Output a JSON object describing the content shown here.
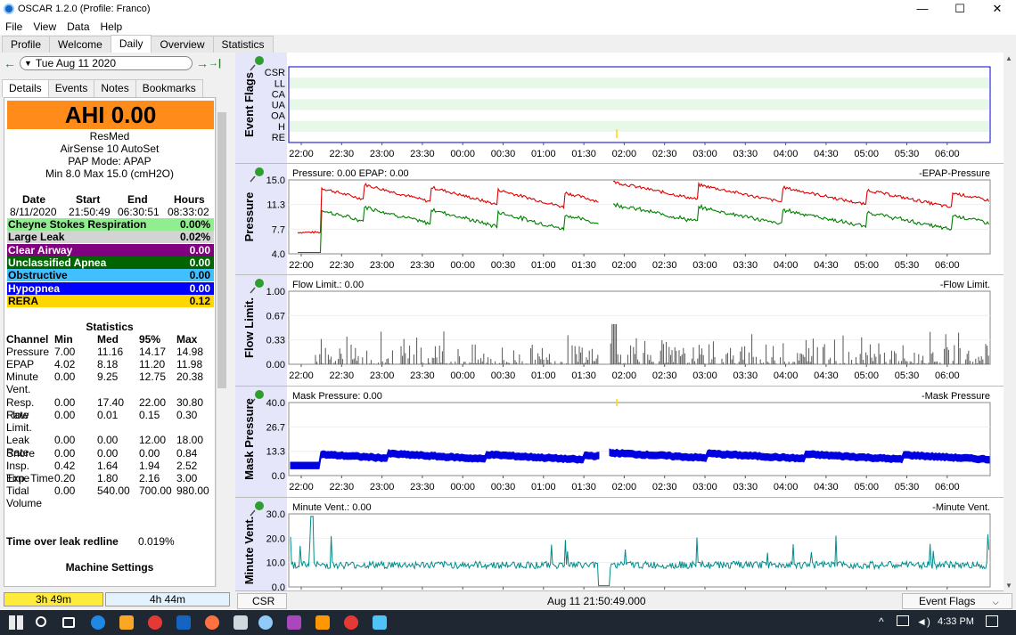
{
  "window": {
    "title": "OSCAR 1.2.0 (Profile: Franco)",
    "minimize": "—",
    "maximize": "☐",
    "close": "✕"
  },
  "menu": [
    "File",
    "View",
    "Data",
    "Help"
  ],
  "tabs": [
    "Profile",
    "Welcome",
    "Daily",
    "Overview",
    "Statistics"
  ],
  "active_tab": "Daily",
  "date": {
    "value": "Tue Aug 11 2020",
    "prev": "←",
    "next": "→",
    "last": "→|"
  },
  "subtabs": [
    "Details",
    "Events",
    "Notes",
    "Bookmarks"
  ],
  "ahi": "AHI 0.00",
  "machine": {
    "brand": "ResMed",
    "model": "AirSense 10 AutoSet",
    "mode": "PAP Mode: APAP",
    "pressure": "Min 8.0 Max 15.0 (cmH2O)"
  },
  "session": {
    "headers": [
      "Date",
      "Start",
      "End",
      "Hours"
    ],
    "values": [
      "8/11/2020",
      "21:50:49",
      "06:30:51",
      "08:33:02"
    ]
  },
  "events": [
    {
      "name": "Cheyne Stokes Respiration",
      "value": "0.00%",
      "color": "#90ee90",
      "text": "#000000"
    },
    {
      "name": "Large Leak",
      "value": "0.02%",
      "color": "#d3d3d3",
      "text": "#000000"
    },
    {
      "name": "Clear Airway",
      "value": "0.00",
      "color": "#800080",
      "text": "#ffffff"
    },
    {
      "name": "Unclassified Apnea",
      "value": "0.00",
      "color": "#006400",
      "text": "#ffffff"
    },
    {
      "name": "Obstructive",
      "value": "0.00",
      "color": "#40c0ff",
      "text": "#000000"
    },
    {
      "name": "Hypopnea",
      "value": "0.00",
      "color": "#0000ff",
      "text": "#ffffff"
    },
    {
      "name": "RERA",
      "value": "0.12",
      "color": "#ffd700",
      "text": "#000000"
    }
  ],
  "statistics": {
    "title": "Statistics",
    "headers": [
      "Channel",
      "Min",
      "Med",
      "95%",
      "Max"
    ],
    "rows": [
      {
        "channel": "Pressure",
        "min": "7.00",
        "med": "11.16",
        "p95": "14.17",
        "max": "14.98"
      },
      {
        "channel": "EPAP",
        "min": "4.02",
        "med": "8.18",
        "p95": "11.20",
        "max": "11.98"
      },
      {
        "channel": "Minute Vent.",
        "min": "0.00",
        "med": "9.25",
        "p95": "12.75",
        "max": "20.38"
      },
      {
        "channel": "Resp. Rate",
        "min": "0.00",
        "med": "17.40",
        "p95": "22.00",
        "max": "30.80"
      },
      {
        "channel": "Flow Limit.",
        "min": "0.00",
        "med": "0.01",
        "p95": "0.15",
        "max": "0.30"
      },
      {
        "channel": "Leak Rate",
        "min": "0.00",
        "med": "0.00",
        "p95": "12.00",
        "max": "18.00"
      },
      {
        "channel": "Snore",
        "min": "0.00",
        "med": "0.00",
        "p95": "0.00",
        "max": "0.84"
      },
      {
        "channel": "Insp. Time",
        "min": "0.42",
        "med": "1.64",
        "p95": "1.94",
        "max": "2.52"
      },
      {
        "channel": "Exp. Time",
        "min": "0.20",
        "med": "1.80",
        "p95": "2.16",
        "max": "3.00"
      },
      {
        "channel": "Tidal Volume",
        "min": "0.00",
        "med": "540.00",
        "p95": "700.00",
        "max": "980.00"
      }
    ]
  },
  "leak_redline": {
    "label": "Time over leak redline",
    "value": "0.019%"
  },
  "machine_settings": "Machine Settings",
  "bottom_bars": [
    "3h 49m",
    "4h 44m"
  ],
  "time_ticks": [
    "22:00",
    "22:30",
    "23:00",
    "23:30",
    "00:00",
    "00:30",
    "01:00",
    "01:30",
    "02:00",
    "02:30",
    "03:00",
    "03:30",
    "04:00",
    "04:30",
    "05:00",
    "05:30",
    "06:00"
  ],
  "graphs": {
    "event_flags": {
      "ylabel": "Event Flags",
      "flags": [
        "CSR",
        "LL",
        "CA",
        "UA",
        "OA",
        "H",
        "RE"
      ]
    },
    "pressure": {
      "ylabel": "Pressure",
      "header": "Pressure: 0.00 EPAP: 0.00",
      "legend": "-EPAP-Pressure",
      "ticks": [
        "15.0",
        "11.3",
        "7.7",
        "4.0"
      ],
      "colors": {
        "pressure": "#e00000",
        "epap": "#008000"
      }
    },
    "flow_limit": {
      "ylabel": "Flow Limit.",
      "header": "Flow Limit.: 0.00",
      "legend": "-Flow Limit.",
      "ticks": [
        "1.00",
        "0.67",
        "0.33",
        "0.00"
      ],
      "color": "#555555"
    },
    "mask_pressure": {
      "ylabel": "Mask Pressure",
      "header": "Mask Pressure: 0.00",
      "legend": "-Mask Pressure",
      "ticks": [
        "40.0",
        "26.7",
        "13.3",
        "0.0"
      ],
      "color": "#0000e0"
    },
    "minute_vent": {
      "ylabel": "Minute Vent.",
      "header": "Minute Vent.: 0.00",
      "legend": "-Minute Vent.",
      "ticks": [
        "30.0",
        "20.0",
        "10.0",
        "0.0"
      ],
      "color": "#008b8b"
    }
  },
  "statusbar": {
    "csr": "CSR",
    "time": "Aug 11 21:50:49.000",
    "flags": "Event Flags"
  },
  "taskbar": {
    "time": "4:33 PM"
  }
}
